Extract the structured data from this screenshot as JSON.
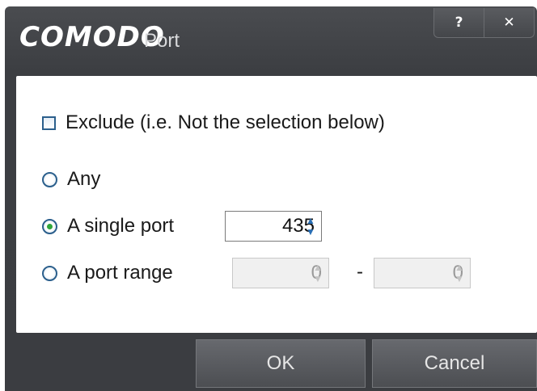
{
  "window": {
    "logo_text": "COMODO",
    "title": "Port",
    "help_label": "?",
    "close_label": "✕"
  },
  "options": {
    "exclude_label": "Exclude (i.e. Not the selection below)",
    "exclude_checked": false,
    "any_label": "Any",
    "single_port_label": "A single port",
    "port_range_label": "A port range",
    "selected": "single_port"
  },
  "single_port": {
    "value": "435"
  },
  "port_range": {
    "from_value": "0",
    "to_value": "0",
    "separator": "-"
  },
  "buttons": {
    "ok_label": "OK",
    "cancel_label": "Cancel"
  },
  "colors": {
    "frame": "#3d3f43",
    "radio_selected": "#2fa63a",
    "spin_arrow": "#2a6fb5"
  }
}
